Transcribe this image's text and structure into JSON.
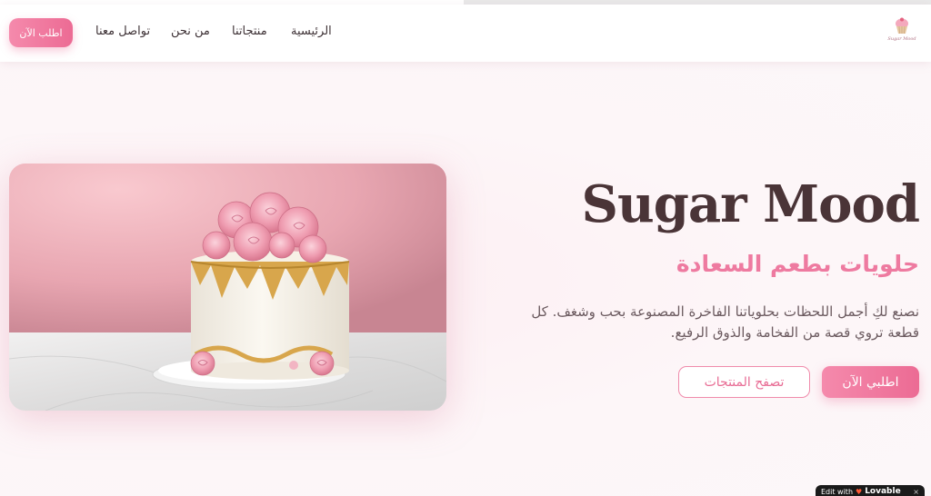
{
  "header": {
    "logo_text": "Sugar Mood",
    "nav": {
      "home": "الرئيسية",
      "products": "منتجاتنا",
      "about": "من نحن",
      "contact": "تواصل معنا"
    },
    "order_button": "اطلب الآن"
  },
  "hero": {
    "title": "Sugar Mood",
    "tagline": "حلويات بطعم السعادة",
    "description": "نصنع لكِ أجمل اللحظات بحلوياتنا الفاخرة المصنوعة بحب وشغف. كل قطعة تروي قصة من الفخامة والذوق الرفيع.",
    "primary_button": "اطلبي الآن",
    "secondary_button": "تصفح المنتجات",
    "image_alt": "Pink roses cake"
  },
  "badge": {
    "prefix": "Edit with",
    "brand": "Lovable",
    "close": "×"
  },
  "colors": {
    "accent": "#ec6b94",
    "title": "#4a3437",
    "background": "#fdf6f8"
  }
}
